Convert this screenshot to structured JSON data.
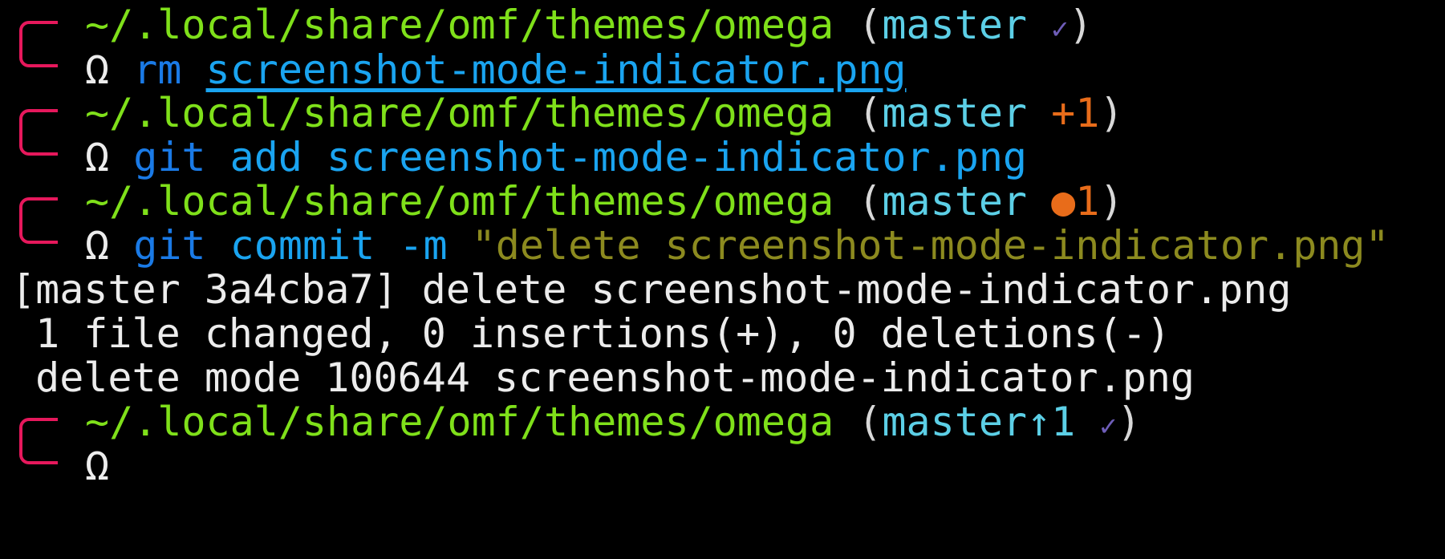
{
  "colors": {
    "background": "#000000",
    "path": "#7fe01a",
    "branch": "#5ccfe6",
    "bracket": "#e6185c",
    "dirty": "#e86c1a",
    "clean": "#6e5db8",
    "command": "#1a7ae6",
    "argument": "#1aa4f0",
    "string": "#8c8a1f",
    "output": "#ececec"
  },
  "prompts": [
    {
      "path": "~/.local/share/omf/themes/omega",
      "branch": "master",
      "status": "✓",
      "symbol": "Ω",
      "command": "rm",
      "args": "screenshot-mode-indicator.png"
    },
    {
      "path": "~/.local/share/omf/themes/omega",
      "branch": "master",
      "status": "+1",
      "symbol": "Ω",
      "command": "git",
      "subcommand": "add",
      "args": "screenshot-mode-indicator.png"
    },
    {
      "path": "~/.local/share/omf/themes/omega",
      "branch": "master",
      "status": "●1",
      "symbol": "Ω",
      "command": "git",
      "subcommand": "commit",
      "flag": "-m",
      "string": "\"delete screenshot-mode-indicator.png\""
    },
    {
      "path": "~/.local/share/omf/themes/omega",
      "branch": "master↑1",
      "status": "✓",
      "symbol": "Ω"
    }
  ],
  "output": [
    "[master 3a4cba7] delete screenshot-mode-indicator.png",
    " 1 file changed, 0 insertions(+), 0 deletions(-)",
    " delete mode 100644 screenshot-mode-indicator.png"
  ]
}
